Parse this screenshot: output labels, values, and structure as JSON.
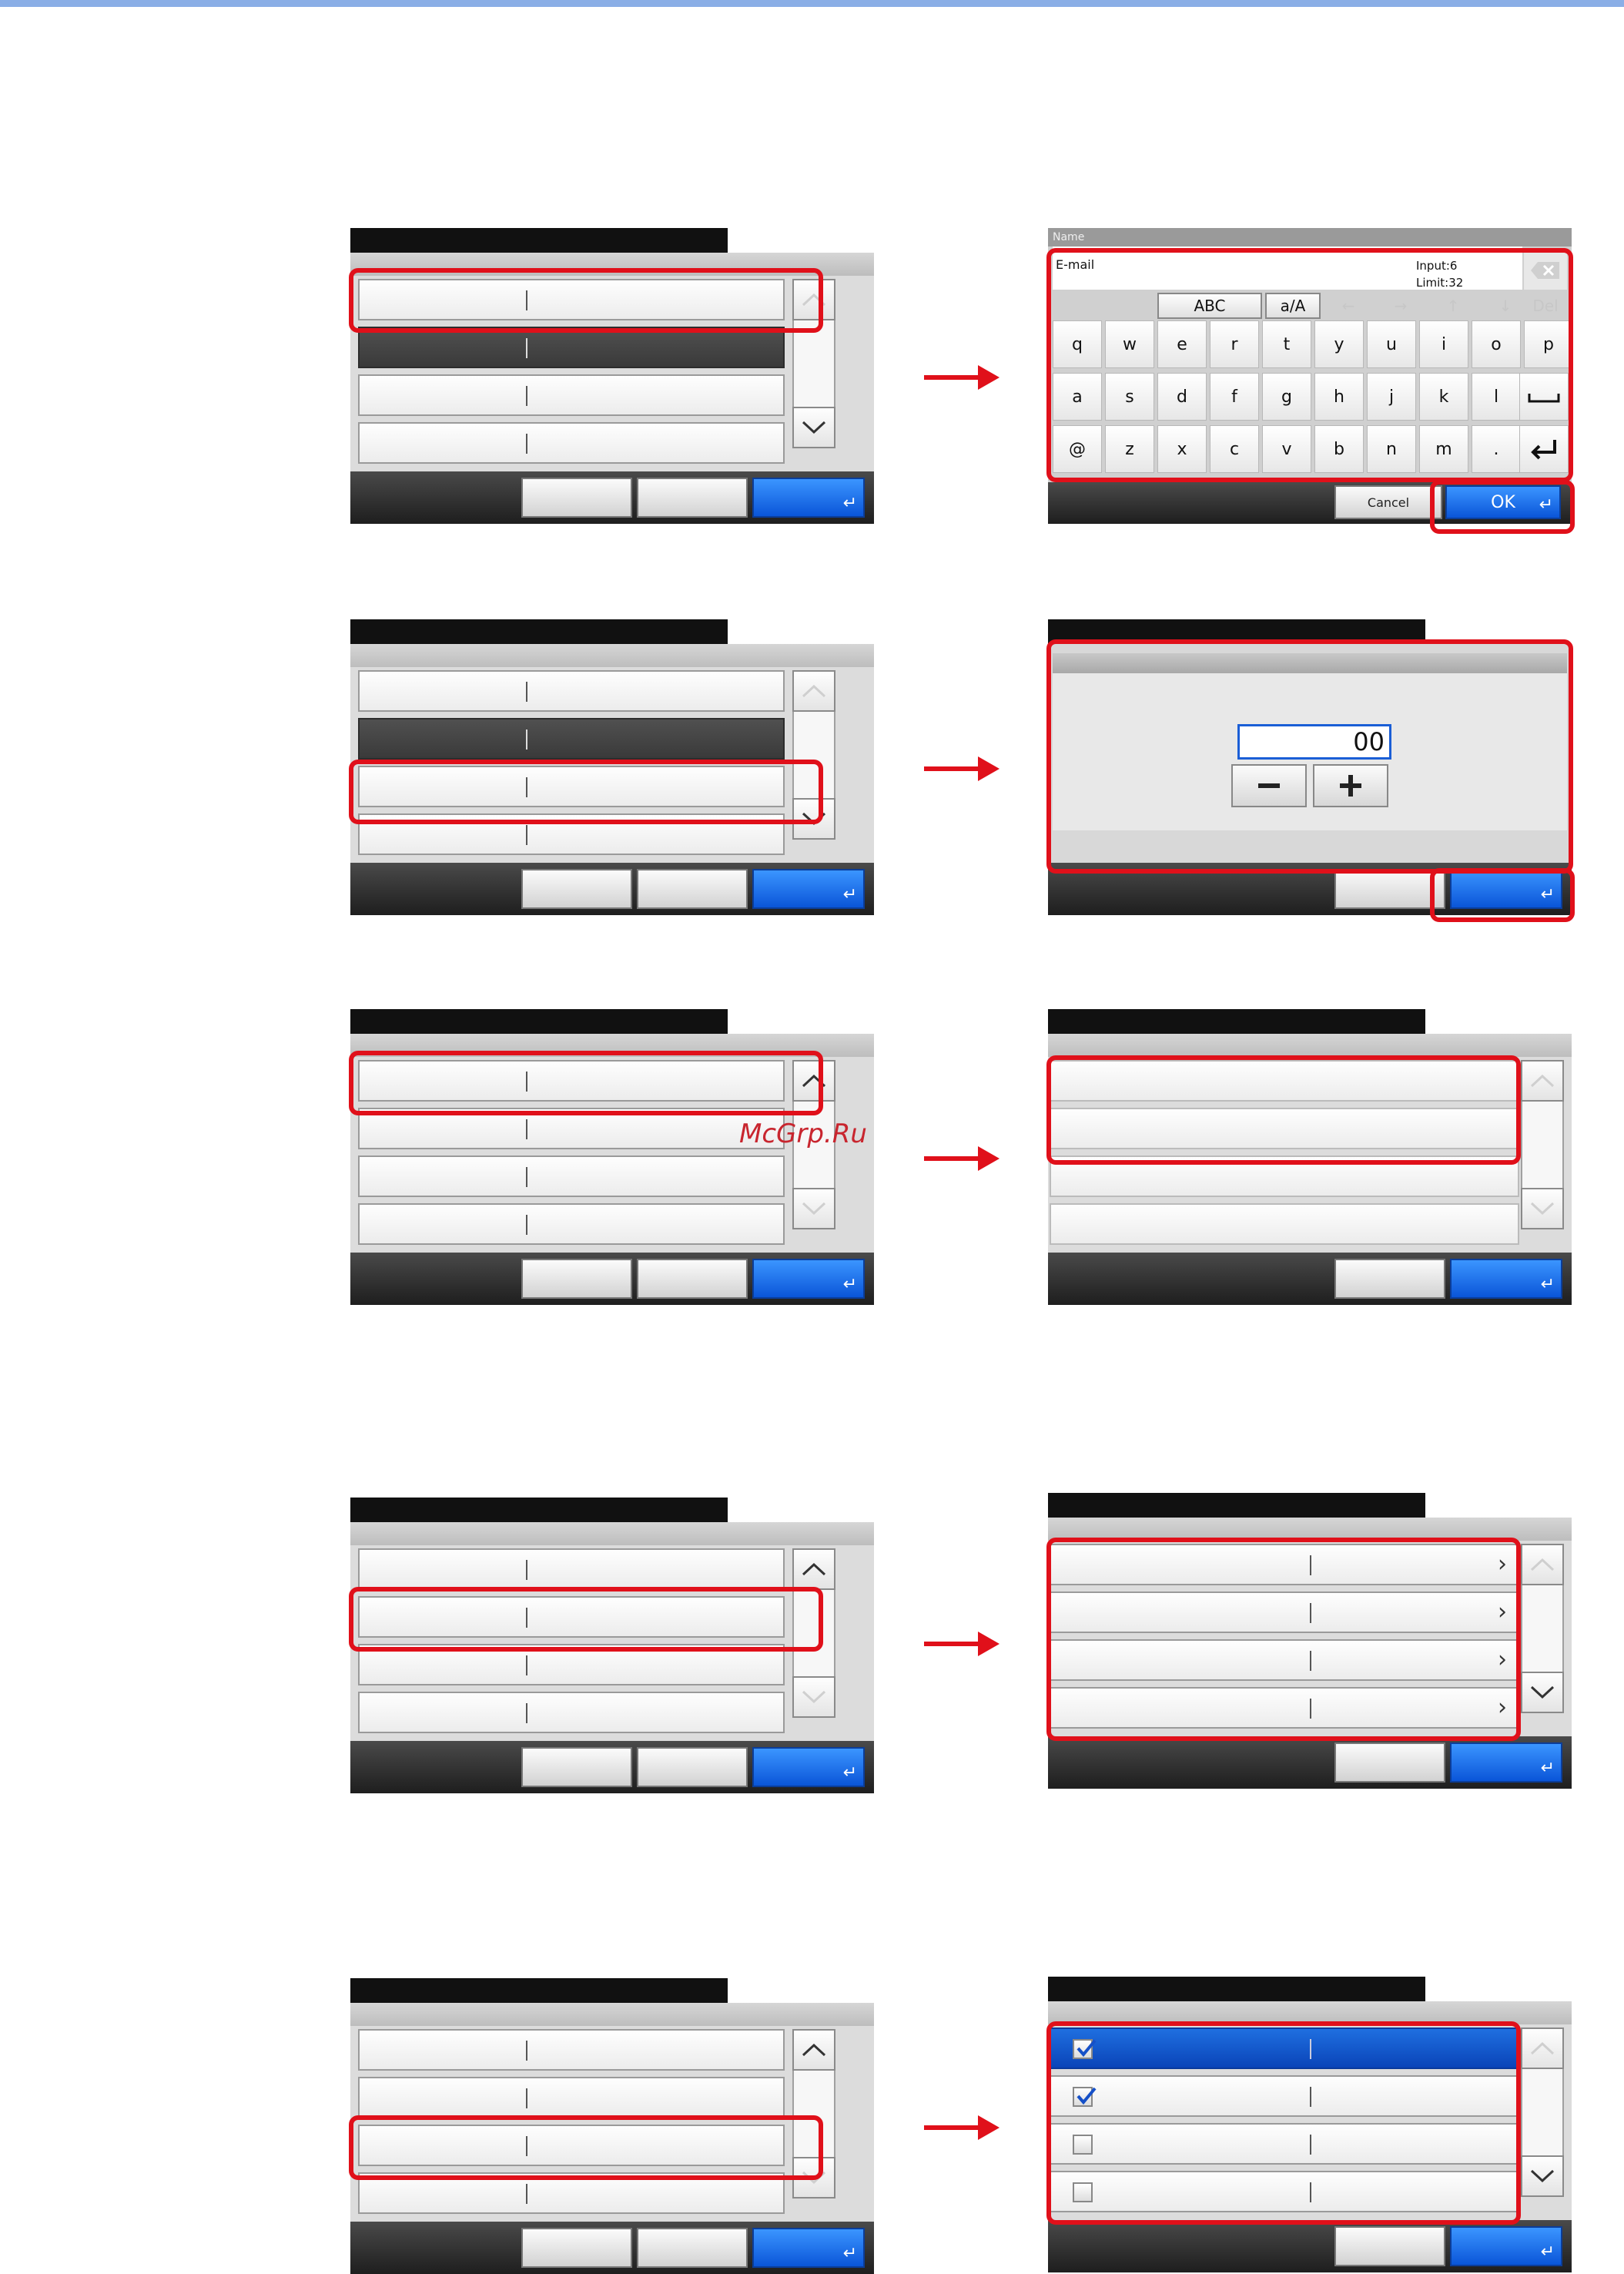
{
  "watermark": "McGrp.Ru",
  "keyboard": {
    "title": "Name",
    "field_label": "E-mail",
    "input_count": "Input:6",
    "limit": "Limit:32",
    "tool_abc": "ABC",
    "tool_case": "a/A",
    "tool_del": "Del",
    "rows": [
      [
        "q",
        "w",
        "e",
        "r",
        "t",
        "y",
        "u",
        "i",
        "o",
        "p"
      ],
      [
        "a",
        "s",
        "d",
        "f",
        "g",
        "h",
        "j",
        "k",
        "l"
      ],
      [
        "@",
        "z",
        "x",
        "c",
        "v",
        "b",
        "n",
        "m",
        "."
      ]
    ],
    "cancel_label": "Cancel",
    "ok_label": "OK"
  },
  "numeric": {
    "value": "00"
  }
}
